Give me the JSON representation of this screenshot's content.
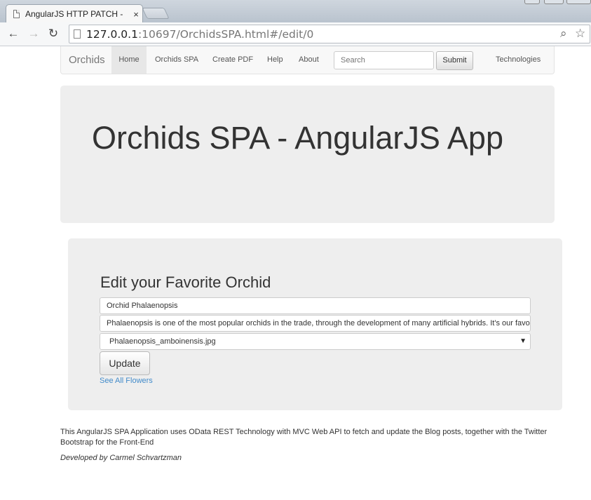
{
  "browser": {
    "tab_title": "AngularJS HTTP PATCH -",
    "tab_close": "×",
    "url_host": "127.0.0.1",
    "url_rest": ":10697/OrchidsSPA.html#/edit/0",
    "back_icon": "←",
    "forward_icon": "→",
    "reload_icon": "↻",
    "search_icon": "⌕",
    "star_icon": "☆"
  },
  "navbar": {
    "brand": "Orchids",
    "items": [
      {
        "label": "Home"
      },
      {
        "label": "Orchids SPA"
      },
      {
        "label": "Create PDF"
      },
      {
        "label": "Help"
      },
      {
        "label": "About"
      }
    ],
    "search_placeholder": "Search",
    "submit_label": "Submit",
    "technologies_label": "Technologies"
  },
  "jumbotron": {
    "title": "Orchids SPA - AngularJS App"
  },
  "edit_form": {
    "heading": "Edit your Favorite Orchid",
    "name_value": "Orchid Phalaenopsis",
    "description_value": "Phalaenopsis is one of the most popular orchids in the trade, through the development of many artificial hybrids. It's our favorite",
    "image_selected": "Phalaenopsis_amboinensis.jpg",
    "select_arrow": "▼",
    "update_label": "Update",
    "see_all_link": "See All Flowers"
  },
  "footer": {
    "text": "This AngularJS SPA Application uses OData REST Technology with MVC Web API to fetch and update the Blog posts, together with the Twitter Bootstrap for the Front-End",
    "credit": "Developed by Carmel Schvartzman"
  },
  "colors": {
    "link": "#428bca",
    "panel_bg": "#eeeeee",
    "navbar_bg": "#f8f8f8",
    "nav_active_bg": "#e7e7e7"
  }
}
